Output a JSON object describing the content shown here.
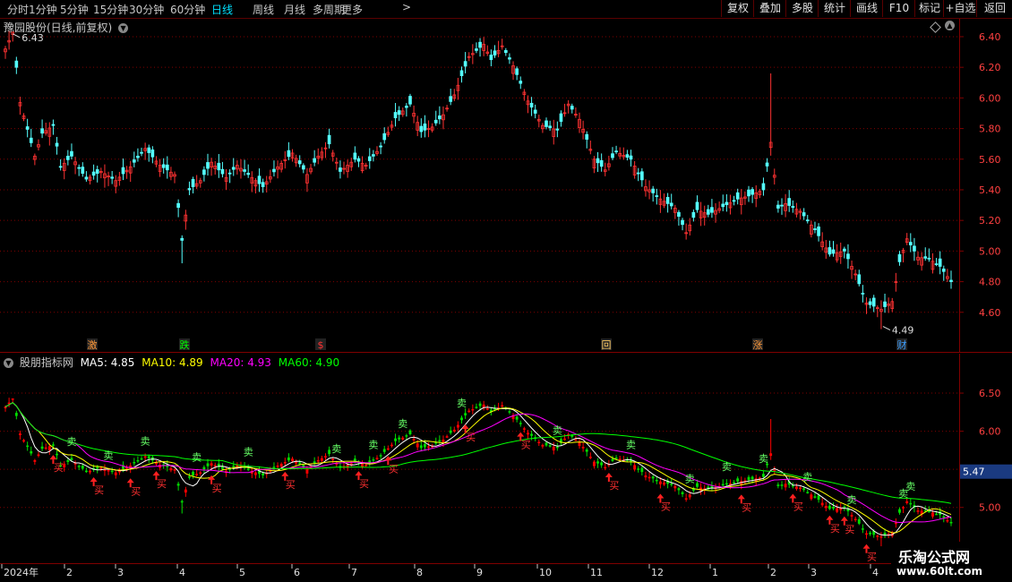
{
  "toolbar": {
    "periods": [
      "分时",
      "1分钟",
      "5分钟",
      "15分钟",
      "30分钟",
      "60分钟",
      "日线",
      "周线",
      "月线",
      "多周期",
      "更多"
    ],
    "active_period": "日线",
    "right_buttons": [
      "复权",
      "叠加",
      "多股",
      "统计",
      "画线",
      "F10",
      "标记",
      "+自选",
      "返回"
    ]
  },
  "main_panel": {
    "title": "豫园股份(日线,前复权)",
    "high_label": "6.43",
    "low_label": "4.49"
  },
  "indicator_panel": {
    "name": "股朋指标网",
    "ma_labels": [
      "MA5: 4.85",
      "MA10: 4.89",
      "MA20: 4.93",
      "MA60: 4.90"
    ],
    "price_tag": "5.47"
  },
  "event_markers": [
    {
      "text": "激",
      "color": "#ff9a3c"
    },
    {
      "text": "跌",
      "color": "#00ff00"
    },
    {
      "text": "$",
      "color": "#ff3333"
    },
    {
      "text": "回",
      "color": "#ffcc66"
    },
    {
      "text": "涨",
      "color": "#ff9a3c"
    },
    {
      "text": "财",
      "color": "#3ea0ff"
    }
  ],
  "signals": {
    "buy_text": "买",
    "sell_text": "卖"
  },
  "x_axis": {
    "labels": [
      "2024年",
      "2",
      "3",
      "4",
      "5",
      "6",
      "7",
      "8",
      "9",
      "10",
      "11",
      "12",
      "1",
      "2",
      "3",
      "4"
    ]
  },
  "watermark": {
    "line1": "乐淘公式网",
    "line2": "www.60lt.com"
  },
  "colors": {
    "up": "#ff3232",
    "down": "#54ffff",
    "ma5": "#ffffff",
    "ma10": "#ffff00",
    "ma20": "#ff00ff",
    "ma60": "#00ff00",
    "grid": "#800000",
    "axis_text": "#ff4040"
  },
  "chart_data": [
    {
      "type": "candlestick",
      "title": "豫园股份(日线,前复权)",
      "y_ticks": [
        4.6,
        4.8,
        5.0,
        5.2,
        5.4,
        5.6,
        5.8,
        6.0,
        6.2,
        6.4
      ],
      "ylim": [
        4.47,
        6.47
      ],
      "x_ticks": [
        "2024年",
        "2",
        "3",
        "4",
        "5",
        "6",
        "7",
        "8",
        "9",
        "10",
        "11",
        "12",
        "1",
        "2",
        "3",
        "4"
      ],
      "anchors": [
        [
          0,
          6.32
        ],
        [
          2,
          6.43
        ],
        [
          4,
          5.97
        ],
        [
          8,
          5.62
        ],
        [
          10,
          5.77
        ],
        [
          13,
          5.82
        ],
        [
          15,
          5.55
        ],
        [
          18,
          5.62
        ],
        [
          22,
          5.47
        ],
        [
          26,
          5.52
        ],
        [
          30,
          5.46
        ],
        [
          34,
          5.55
        ],
        [
          38,
          5.67
        ],
        [
          42,
          5.56
        ],
        [
          46,
          5.5
        ],
        [
          48,
          5.07
        ],
        [
          50,
          5.4
        ],
        [
          53,
          5.46
        ],
        [
          56,
          5.58
        ],
        [
          60,
          5.48
        ],
        [
          63,
          5.56
        ],
        [
          66,
          5.5
        ],
        [
          70,
          5.42
        ],
        [
          74,
          5.55
        ],
        [
          78,
          5.64
        ],
        [
          82,
          5.5
        ],
        [
          85,
          5.62
        ],
        [
          88,
          5.7
        ],
        [
          91,
          5.52
        ],
        [
          95,
          5.6
        ],
        [
          98,
          5.56
        ],
        [
          102,
          5.68
        ],
        [
          106,
          5.87
        ],
        [
          110,
          5.96
        ],
        [
          113,
          5.78
        ],
        [
          116,
          5.81
        ],
        [
          119,
          5.89
        ],
        [
          122,
          6.02
        ],
        [
          126,
          6.27
        ],
        [
          130,
          6.35
        ],
        [
          132,
          6.25
        ],
        [
          135,
          6.34
        ],
        [
          138,
          6.21
        ],
        [
          142,
          5.98
        ],
        [
          146,
          5.82
        ],
        [
          150,
          5.79
        ],
        [
          153,
          5.96
        ],
        [
          156,
          5.86
        ],
        [
          160,
          5.6
        ],
        [
          163,
          5.53
        ],
        [
          166,
          5.65
        ],
        [
          170,
          5.6
        ],
        [
          174,
          5.42
        ],
        [
          178,
          5.34
        ],
        [
          182,
          5.28
        ],
        [
          185,
          5.12
        ],
        [
          188,
          5.27
        ],
        [
          191,
          5.24
        ],
        [
          195,
          5.29
        ],
        [
          199,
          5.34
        ],
        [
          202,
          5.36
        ],
        [
          206,
          5.4
        ],
        [
          208,
          5.71
        ],
        [
          210,
          5.28
        ],
        [
          212,
          5.31
        ],
        [
          216,
          5.26
        ],
        [
          220,
          5.14
        ],
        [
          224,
          4.98
        ],
        [
          228,
          5.0
        ],
        [
          231,
          4.85
        ],
        [
          234,
          4.66
        ],
        [
          238,
          4.62
        ],
        [
          241,
          4.67
        ],
        [
          243,
          4.93
        ],
        [
          245,
          5.08
        ],
        [
          248,
          4.96
        ],
        [
          251,
          4.95
        ],
        [
          254,
          4.9
        ],
        [
          257,
          4.8
        ]
      ],
      "notes": "Daily candles Jan 2024 - Apr 2025, values read approximately from the chart"
    },
    {
      "type": "line",
      "title": "股朋指标网",
      "series": [
        {
          "name": "MA5",
          "value": 4.85
        },
        {
          "name": "MA10",
          "value": 4.89
        },
        {
          "name": "MA20",
          "value": 4.93
        },
        {
          "name": "MA60",
          "value": 4.9
        }
      ],
      "y_ticks": [
        5.0,
        5.5,
        6.0,
        6.5
      ],
      "ylim": [
        4.55,
        6.9
      ]
    }
  ]
}
